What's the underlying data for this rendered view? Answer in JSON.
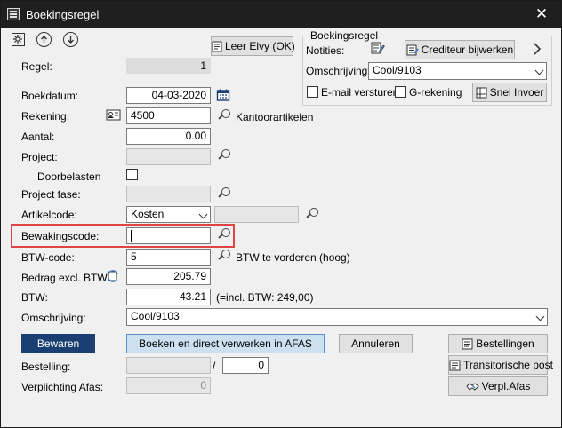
{
  "window": {
    "title": "Boekingsregel",
    "close_glyph": "✕"
  },
  "toolbar": {
    "learn_button": "Leer Elvy (OK)"
  },
  "group": {
    "title": "Boekingsregel",
    "notes_label": "Notities:",
    "creditor_button": "Crediteur bijwerken",
    "description_label": "Omschrijving:",
    "description_value": "Cool/9103",
    "email_label": "E-mail versturen",
    "g_account_label": "G-rekening",
    "quick_entry_button": "Snel Invoer"
  },
  "form": {
    "regel_label": "Regel:",
    "regel_value": "1",
    "boekdatum_label": "Boekdatum:",
    "boekdatum_value": "04-03-2020",
    "rekening_label": "Rekening:",
    "rekening_value": "4500",
    "rekening_name": "Kantoorartikelen",
    "aantal_label": "Aantal:",
    "aantal_value": "0.00",
    "project_label": "Project:",
    "doorbelasten_label": "Doorbelasten",
    "project_fase_label": "Project fase:",
    "artikelcode_label": "Artikelcode:",
    "artikelcode_value": "Kosten",
    "bewakingscode_label": "Bewakingscode:",
    "btw_code_label": "BTW-code:",
    "btw_code_value": "5",
    "btw_code_name": "BTW te vorderen (hoog)",
    "bedrag_label": "Bedrag excl. BTW:",
    "bedrag_value": "205.79",
    "btw_label": "BTW:",
    "btw_value": "43.21",
    "btw_incl_note": "(=incl. BTW: 249,00)",
    "omschrijving_label": "Omschrijving:",
    "omschrijving_value": "Cool/9103"
  },
  "actions": {
    "save": "Bewaren",
    "book_process": "Boeken en direct verwerken in AFAS",
    "cancel": "Annuleren",
    "orders": "Bestellingen",
    "transit": "Transitorische post",
    "commit": "Verpl.Afas"
  },
  "bottom": {
    "bestelling_label": "Bestelling:",
    "slash": "/",
    "bestelling_count": "0",
    "verplichting_label": "Verplichting Afas:",
    "verplichting_value": "0"
  },
  "colors": {
    "primary": "#1a3f73",
    "highlight": "#e04545",
    "titlebar": "#1f1f1f"
  }
}
